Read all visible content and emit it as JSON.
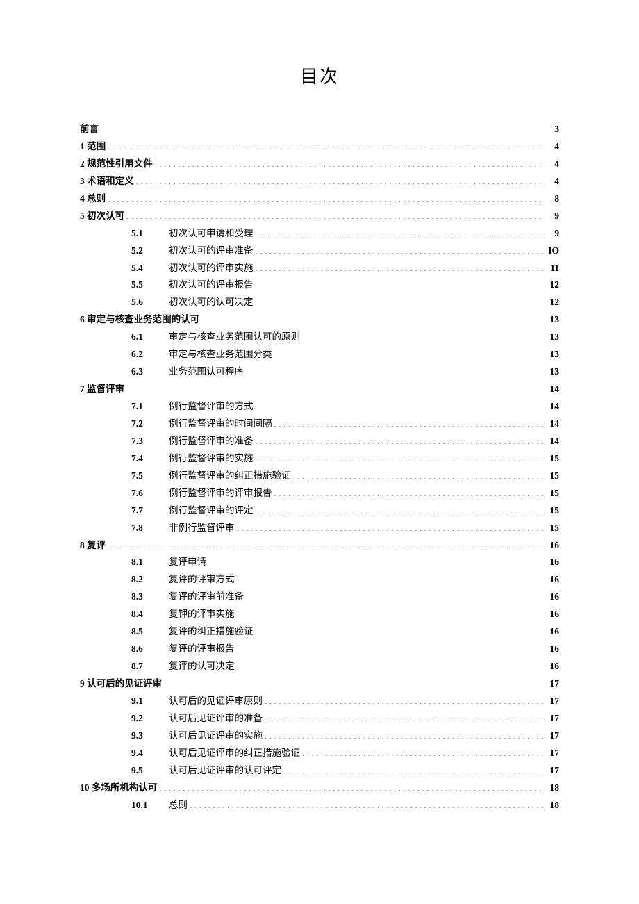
{
  "title": "目次",
  "toc": [
    {
      "level": "top",
      "label": "前言",
      "page": "3"
    },
    {
      "level": "top",
      "label": "1 范围",
      "page": "4"
    },
    {
      "level": "top",
      "label": "2 规范性引用文件",
      "page": "4"
    },
    {
      "level": "top",
      "label": "3 术语和定义",
      "page": "4"
    },
    {
      "level": "top",
      "label": "4 总则",
      "page": "8"
    },
    {
      "level": "top",
      "label": "5 初次认可",
      "page": "9"
    },
    {
      "level": "sub",
      "num": "5.1",
      "label": "初次认可申请和受理",
      "page": "9"
    },
    {
      "level": "sub",
      "num": "5.2",
      "label": "初次认可的评审准备",
      "page": "IO"
    },
    {
      "level": "sub",
      "num": "5.4",
      "label": "初次认可的评审实施",
      "page": "11"
    },
    {
      "level": "sub",
      "num": "5.5",
      "label": "初次认可的评审报告",
      "page": "12"
    },
    {
      "level": "sub",
      "num": "5.6",
      "label": "初次认可的认可决定",
      "page": "12"
    },
    {
      "level": "top",
      "label": "6 审定与核查业务范围的认可",
      "page": "13"
    },
    {
      "level": "sub",
      "num": "6.1",
      "label": "审定与核查业务范围认可的原则",
      "page": "13"
    },
    {
      "level": "sub",
      "num": "6.2",
      "label": "审定与核查业务范围分类",
      "page": "13"
    },
    {
      "level": "sub",
      "num": "6.3",
      "label": "业务范围认可程序",
      "page": "13"
    },
    {
      "level": "top",
      "label": "7 监督评审",
      "page": "14"
    },
    {
      "level": "sub",
      "num": "7.1",
      "label": "例行监督评审的方式",
      "page": "14"
    },
    {
      "level": "sub",
      "num": "7.2",
      "label": "例行监督评审的时间间隔",
      "page": "14"
    },
    {
      "level": "sub",
      "num": "7.3",
      "label": "例行监督评审的准备",
      "page": "14"
    },
    {
      "level": "sub",
      "num": "7.4",
      "label": "例行监督评审的实施",
      "page": "15"
    },
    {
      "level": "sub",
      "num": "7.5",
      "label": "例行监督评审的纠正措施验证",
      "page": "15"
    },
    {
      "level": "sub",
      "num": "7.6",
      "label": "例行监督评审的评审报告",
      "page": "15"
    },
    {
      "level": "sub",
      "num": "7.7",
      "label": "例行监督评审的评定",
      "page": "15"
    },
    {
      "level": "sub",
      "num": "7.8",
      "label": "非例行监督评审",
      "page": "15"
    },
    {
      "level": "top",
      "label": "8 复评",
      "page": "16"
    },
    {
      "level": "sub",
      "num": "8.1",
      "label": "复评申请",
      "page": "16"
    },
    {
      "level": "sub",
      "num": "8.2",
      "label": "复评的评审方式",
      "page": "16"
    },
    {
      "level": "sub",
      "num": "8.3",
      "label": "复评的评审前准备",
      "page": "16"
    },
    {
      "level": "sub",
      "num": "8.4",
      "label": "复钾的评审实施",
      "page": "16"
    },
    {
      "level": "sub",
      "num": "8.5",
      "label": "复评的纠正措施验证",
      "page": "16"
    },
    {
      "level": "sub",
      "num": "8.6",
      "label": "复评的评审报告",
      "page": "16"
    },
    {
      "level": "sub",
      "num": "8.7",
      "label": "复评的认可决定",
      "page": "16"
    },
    {
      "level": "top",
      "label": "9 认可后的见证评审",
      "page": "17"
    },
    {
      "level": "sub",
      "num": "9.1",
      "label": "认可后的见证评审原则",
      "page": "17"
    },
    {
      "level": "sub",
      "num": "9.2",
      "label": "认可后见证评审的准备",
      "page": "17"
    },
    {
      "level": "sub",
      "num": "9.3",
      "label": "认可后见证评审的实施",
      "page": "17"
    },
    {
      "level": "sub",
      "num": "9.4",
      "label": "认可后见证评审的纠正措施验证",
      "page": "17"
    },
    {
      "level": "sub",
      "num": "9.5",
      "label": "认可后见证评审的认可评定",
      "page": "17"
    },
    {
      "level": "top",
      "label": "10 多场所机构认可",
      "page": "18"
    },
    {
      "level": "sub",
      "num": "10.1",
      "label": "总则",
      "page": "18"
    }
  ]
}
